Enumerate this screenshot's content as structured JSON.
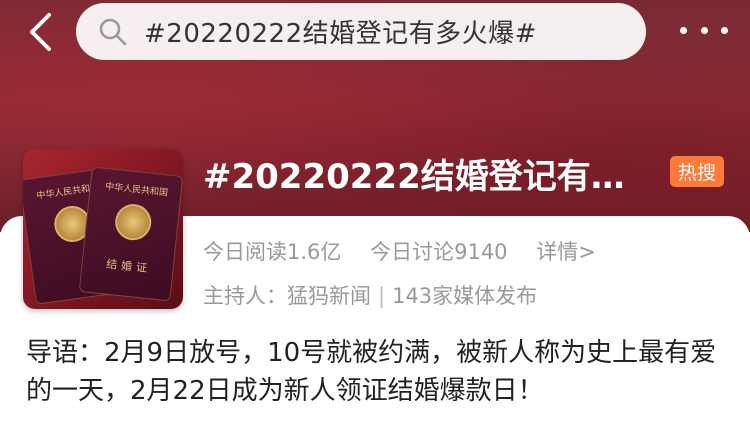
{
  "header": {
    "back_icon": "back-chevron-icon",
    "search_icon": "search-icon",
    "search_text": "#20220222结婚登记有多火爆#",
    "more_icon": "more-dots-icon"
  },
  "topic": {
    "title": "#20220222结婚登记有多…",
    "hot_badge": "热搜",
    "cover": {
      "booklet_title": "中华人民共和国",
      "booklet_name": "结婚证"
    },
    "stats": {
      "reads": "今日阅读1.6亿",
      "discussions": "今日讨论9140",
      "detail": "详情>"
    },
    "host_label": "主持人：猛犸新闻",
    "media_count": "143家媒体发布",
    "intro": "导语：2月9日放号，10号就被约满，被新人称为史上最有爱的一天，2月22日成为新人领证结婚爆款日！"
  },
  "colors": {
    "hero_bg": "#7a2a35",
    "hot_badge": "#ff7a3a",
    "muted_text": "#999999"
  }
}
